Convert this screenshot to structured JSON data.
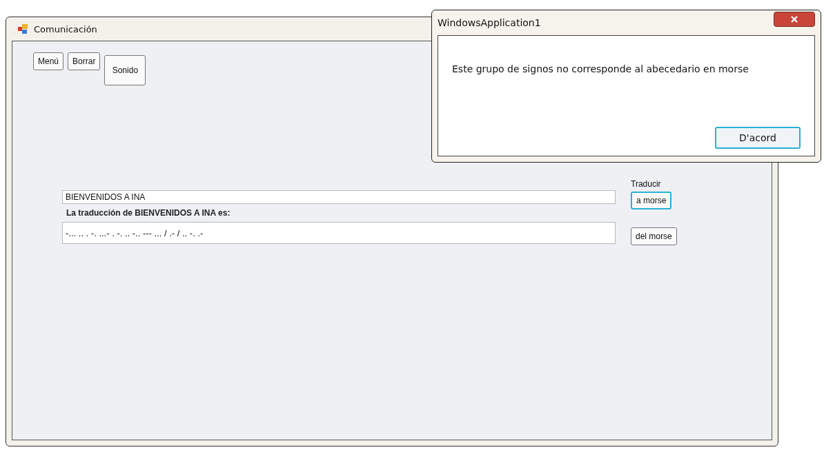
{
  "window": {
    "title": "Comunicación"
  },
  "toolbar": [
    {
      "label": "Menú",
      "kind": "small",
      "focused": false
    },
    {
      "label": "Borrar",
      "kind": "small",
      "focused": false
    },
    {
      "label": "Sonido",
      "kind": "large",
      "focused": false
    }
  ],
  "input": {
    "value": "BIENVENIDOS A INA"
  },
  "result_label": "La traducción de BIENVENIDOS A INA es:",
  "output": {
    "value": "-... .. . -. ...- . -. .. -.. --- ... / .- / .. -. .-"
  },
  "translate_label": "Traducir",
  "translate_buttons": [
    {
      "label": "a morse",
      "focused": true
    },
    {
      "label": "del morse",
      "focused": false
    }
  ],
  "dialog": {
    "title": "WindowsApplication1",
    "message": "Este grupo de signos no corresponde al abecedario en morse",
    "button": {
      "label": "D'acord",
      "focused": true
    }
  }
}
